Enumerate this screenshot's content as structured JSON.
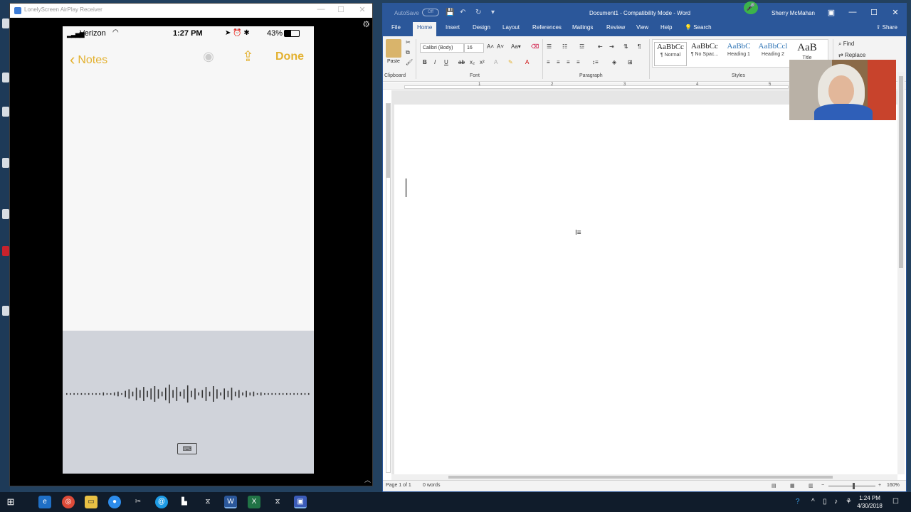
{
  "lonelyscreen": {
    "title": "LonelyScreen AirPlay Receiver",
    "window_controls": [
      "—",
      "☐",
      "✕"
    ],
    "phone": {
      "status": {
        "carrier": "Verizon",
        "time": "1:27 PM",
        "battery": "43%"
      },
      "nav": {
        "back_label": "Notes",
        "done_label": "Done"
      },
      "keyboard_glyph": "⌨"
    }
  },
  "word": {
    "autosave_label": "AutoSave",
    "autosave_state": "Off",
    "doc_title": "Document1  -  Compatibility Mode  -  Word",
    "user_name": "Sherry McMahan",
    "window_controls": [
      "—",
      "☐",
      "✕"
    ],
    "tabs": [
      {
        "label": "File"
      },
      {
        "label": "Home"
      },
      {
        "label": "Insert"
      },
      {
        "label": "Design"
      },
      {
        "label": "Layout"
      },
      {
        "label": "References"
      },
      {
        "label": "Mailings"
      },
      {
        "label": "Review"
      },
      {
        "label": "View"
      },
      {
        "label": "Help"
      },
      {
        "label": "Search"
      }
    ],
    "share_label": "Share",
    "ribbon": {
      "paste_label": "Paste",
      "font_name": "Calibri (Body)",
      "font_size": "16",
      "groups": [
        "Clipboard",
        "Font",
        "Paragraph",
        "Styles"
      ],
      "styles": [
        {
          "preview": "AaBbCc",
          "name": "¶ Normal"
        },
        {
          "preview": "AaBbCc",
          "name": "¶ No Spac..."
        },
        {
          "preview": "AaBbC",
          "name": "Heading 1"
        },
        {
          "preview": "AaBbCcl",
          "name": "Heading 2"
        },
        {
          "preview": "AaB",
          "name": "Title"
        }
      ],
      "find_label": "Find",
      "replace_label": "Replace"
    },
    "ruler_numbers": [
      "1",
      "2",
      "3",
      "4",
      "5"
    ],
    "status": {
      "page": "Page 1 of 1",
      "words": "0 words",
      "zoom": "160%"
    }
  },
  "taskbar": {
    "clock_time": "1:24 PM",
    "clock_date": "4/30/2018"
  }
}
